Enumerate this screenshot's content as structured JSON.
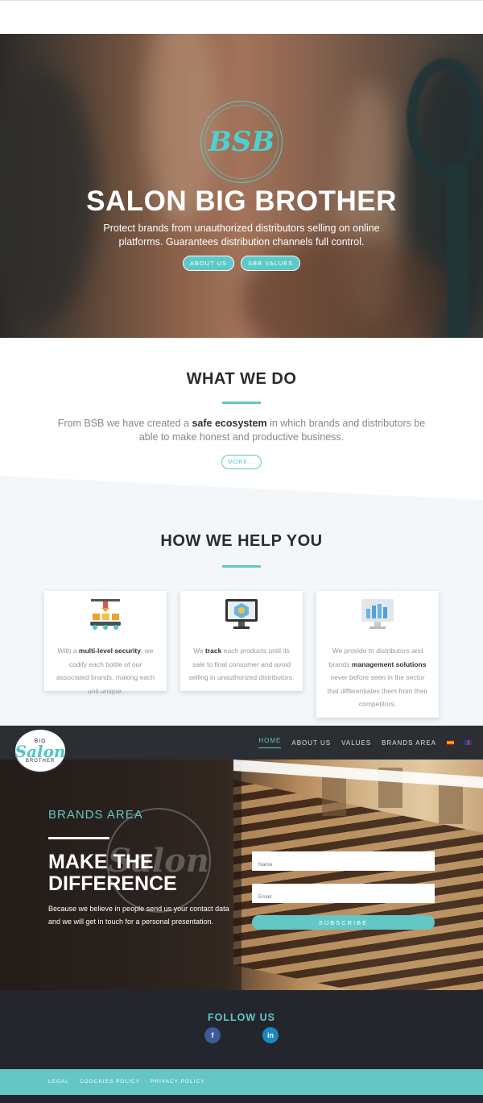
{
  "hero": {
    "logo_text": "BSB",
    "title": "SALON BIG BROTHER",
    "subtitle": "Protect brands from unauthorized distributors selling on online platforms. Guarantees distribution channels full control.",
    "buttons": [
      "ABOUT US",
      "SBB VALUES"
    ]
  },
  "what_we_do": {
    "title": "WHAT WE DO",
    "text_before": "From BSB we have created a ",
    "text_bold": "safe ecosystem",
    "text_after": " in which brands and distributors be able to make honest and productive business.",
    "more_button": "MORE..."
  },
  "how_we_help": {
    "title": "HOW WE HELP YOU",
    "cards": [
      {
        "icon": "factory-robot-icon",
        "pre": "With a ",
        "bold": "multi-level security",
        "post": ", we codify each bottle of our associated brands, making each unit unique."
      },
      {
        "icon": "monitor-tracking-icon",
        "pre": "We ",
        "bold": "track",
        "post": " each products until its sale to final consumer and avoid selling in unauthorized distributors."
      },
      {
        "icon": "monitor-chart-icon",
        "pre": "We provide to distributors and brands ",
        "bold": "management solutions",
        "post": " never before seen in the sector that differentiates them from their competitors."
      }
    ]
  },
  "nav": {
    "logo_top": "BIG",
    "logo_main": "Salon",
    "logo_bottom": "BROTHER",
    "items": [
      "HOME",
      "ABOUT US",
      "VALUES",
      "BRANDS AREA"
    ],
    "active": "HOME",
    "languages": [
      "es-flag-icon",
      "uk-flag-icon"
    ]
  },
  "brands_area": {
    "label": "BRANDS AREA",
    "title": "MAKE THE DIFFERENCE",
    "description": "Because we believe in people send us your contact data and we will get in touch for a personal presentation.",
    "name_placeholder": "Name",
    "email_placeholder": "Email",
    "subscribe_label": "SUBSCRIBE",
    "watermark_text": "Salon"
  },
  "follow": {
    "title": "FOLLOW US",
    "facebook": "f",
    "linkedin": "in"
  },
  "footer": {
    "links": [
      "LEGAL",
      "COOCKIES POLICY",
      "PRIVACY POLICY"
    ]
  },
  "colors": {
    "accent": "#63c7c6",
    "dark": "#2b2e33"
  }
}
